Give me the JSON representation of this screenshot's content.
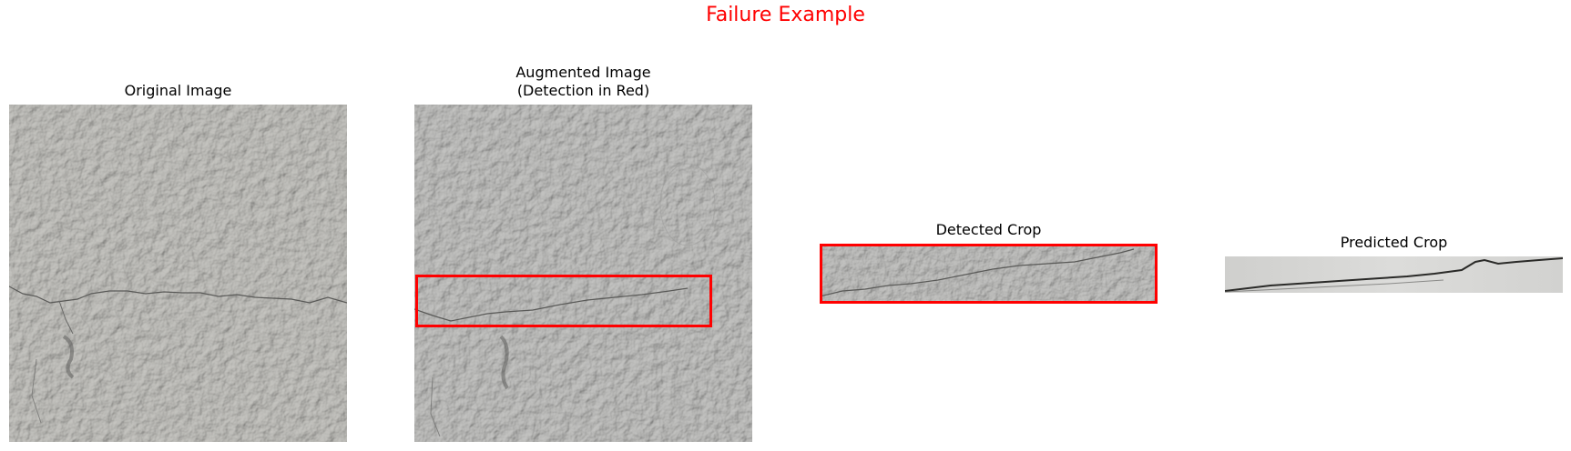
{
  "figure": {
    "title": "Failure Example",
    "title_color": "#ff0000",
    "detection_box_color": "#ff0000"
  },
  "panels": {
    "original": {
      "title": "Original Image"
    },
    "augmented": {
      "title_line1": "Augmented Image",
      "title_line2": "(Detection in Red)"
    },
    "detected": {
      "title": "Detected Crop"
    },
    "predicted": {
      "title": "Predicted Crop"
    }
  }
}
